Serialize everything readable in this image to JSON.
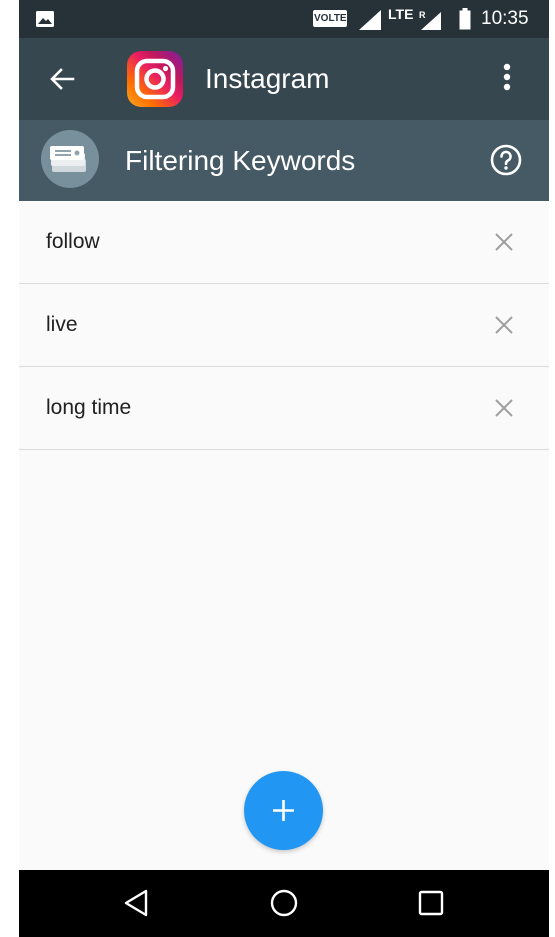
{
  "status_bar": {
    "volte": "VOLTE",
    "lte": "LTE",
    "time": "10:35",
    "icons": [
      "image-icon",
      "signal-icon",
      "lte-icon",
      "roaming-signal-icon",
      "battery-icon"
    ]
  },
  "app_bar": {
    "title": "Instagram",
    "icons": [
      "back-arrow-icon",
      "instagram-logo-icon",
      "more-vert-icon"
    ]
  },
  "section": {
    "title": "Filtering Keywords",
    "icons": [
      "filter-cards-icon",
      "help-icon"
    ]
  },
  "keywords": [
    {
      "label": "follow"
    },
    {
      "label": "live"
    },
    {
      "label": "long time"
    }
  ],
  "fab": {
    "icon": "plus-icon",
    "color": "#2196f3"
  },
  "nav_bar": {
    "icons": [
      "back-triangle-icon",
      "home-circle-icon",
      "recents-square-icon"
    ]
  },
  "colors": {
    "status_bar": "#263238",
    "app_bar": "#37474f",
    "section_header": "#455a64",
    "background": "#fafafa"
  }
}
